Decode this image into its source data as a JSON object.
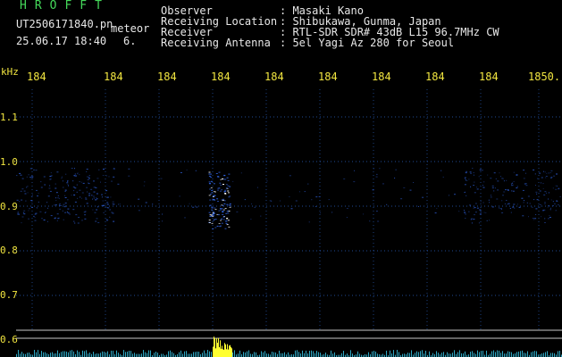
{
  "header": {
    "logo": "HROFFT",
    "filename": "UT2506171840.pn",
    "meteor_label": "meteor",
    "datetime": "25.06.17 18:40",
    "meteor_count": "6."
  },
  "info": [
    {
      "label": "Observer",
      "value": ": Masaki Kano"
    },
    {
      "label": "Receiving Location",
      "value": ": Shibukawa, Gunma, Japan"
    },
    {
      "label": "Receiver",
      "value": ": RTL-SDR SDR# 43dB L15 96.7MHz CW"
    },
    {
      "label": "Receiving Antenna",
      "value": ": 5el Yagi Az 280 for Seoul"
    }
  ],
  "axis": {
    "unit": "kHz",
    "y_labels": [
      "1.1",
      "1.0",
      "0.9",
      "0.8",
      "0.7",
      "0.6"
    ],
    "x_labels": [
      "184",
      "184",
      "184",
      "184",
      "184",
      "184",
      "184",
      "184",
      "184",
      "1850."
    ]
  },
  "colors": {
    "background": "#000000",
    "header_green": "#44d85a",
    "axis_yellow": "#f2e640",
    "grid": "#2a5db8",
    "signal_blue": "#2f62e0",
    "signal_white": "#ffffff",
    "level_cyan": "#36c6e6",
    "level_yellow": "#ffff30"
  }
}
